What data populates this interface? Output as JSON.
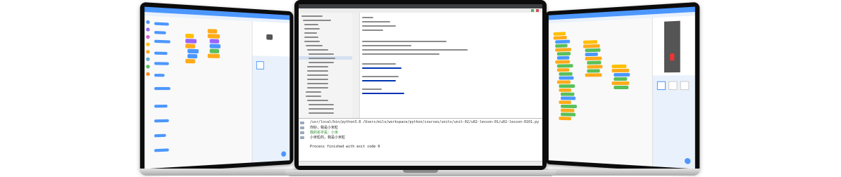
{
  "console": {
    "command": "/usr/local/bin/python3.8 /Users/milo/workspace/python/courses/units/unit-02/u02-lesson-01/u02-lesson-0101.py",
    "lines": [
      "你好，我是小米粒",
      "我的名字是：小米",
      "小米粒的，我是小米粒"
    ],
    "exit": "Process finished with exit code 0"
  },
  "colors": {
    "scratch_blue": "#4c97ff",
    "looks_purple": "#9966ff",
    "control_orange": "#ffab19",
    "operators_green": "#59c059",
    "events_yellow": "#ffbf00",
    "ide_dark": "#3c3f41"
  },
  "icons": [
    "scratch-logo-icon",
    "add-sprite-icon",
    "run-icon",
    "stop-icon",
    "python-file-icon",
    "folder-icon",
    "car-sprite-icon"
  ]
}
